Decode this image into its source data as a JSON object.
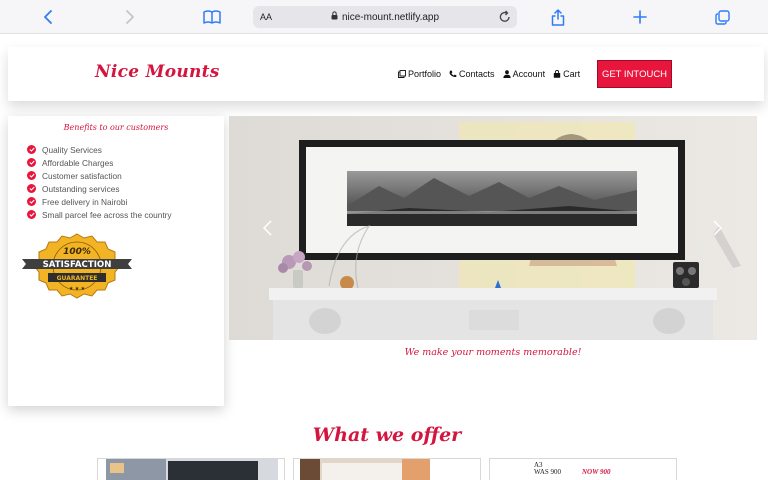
{
  "browser": {
    "text_size_label": "AA",
    "url": "nice-mount.netlify.app"
  },
  "header": {
    "logo": "Nice Mounts",
    "nav": [
      {
        "label": "Portfolio",
        "icon": "portfolio-icon"
      },
      {
        "label": "Contacts",
        "icon": "phone-icon"
      },
      {
        "label": "Account",
        "icon": "user-icon"
      },
      {
        "label": "Cart",
        "icon": "bag-icon"
      }
    ],
    "cta_label": "GET INTOUCH"
  },
  "sidebar": {
    "title": "Benefits to our customers",
    "benefits": [
      "Quality Services",
      "Affordable Charges",
      "Customer satisfaction",
      "Outstanding services",
      "Free delivery in Nairobi",
      "Small parcel fee across the country"
    ],
    "badge": {
      "percent": "100%",
      "word": "SATISFACTION",
      "ribbon": "GUARANTEE"
    }
  },
  "hero": {
    "tagline": "We make your moments memorable!"
  },
  "offer": {
    "title": "What we offer",
    "card3_text_a": "A3",
    "card3_text_b": "WAS 900",
    "card3_text_c": "NOW 900"
  },
  "colors": {
    "brand": "#d3153f",
    "cta": "#e8153c",
    "safari_blue": "#2f7cf6"
  }
}
